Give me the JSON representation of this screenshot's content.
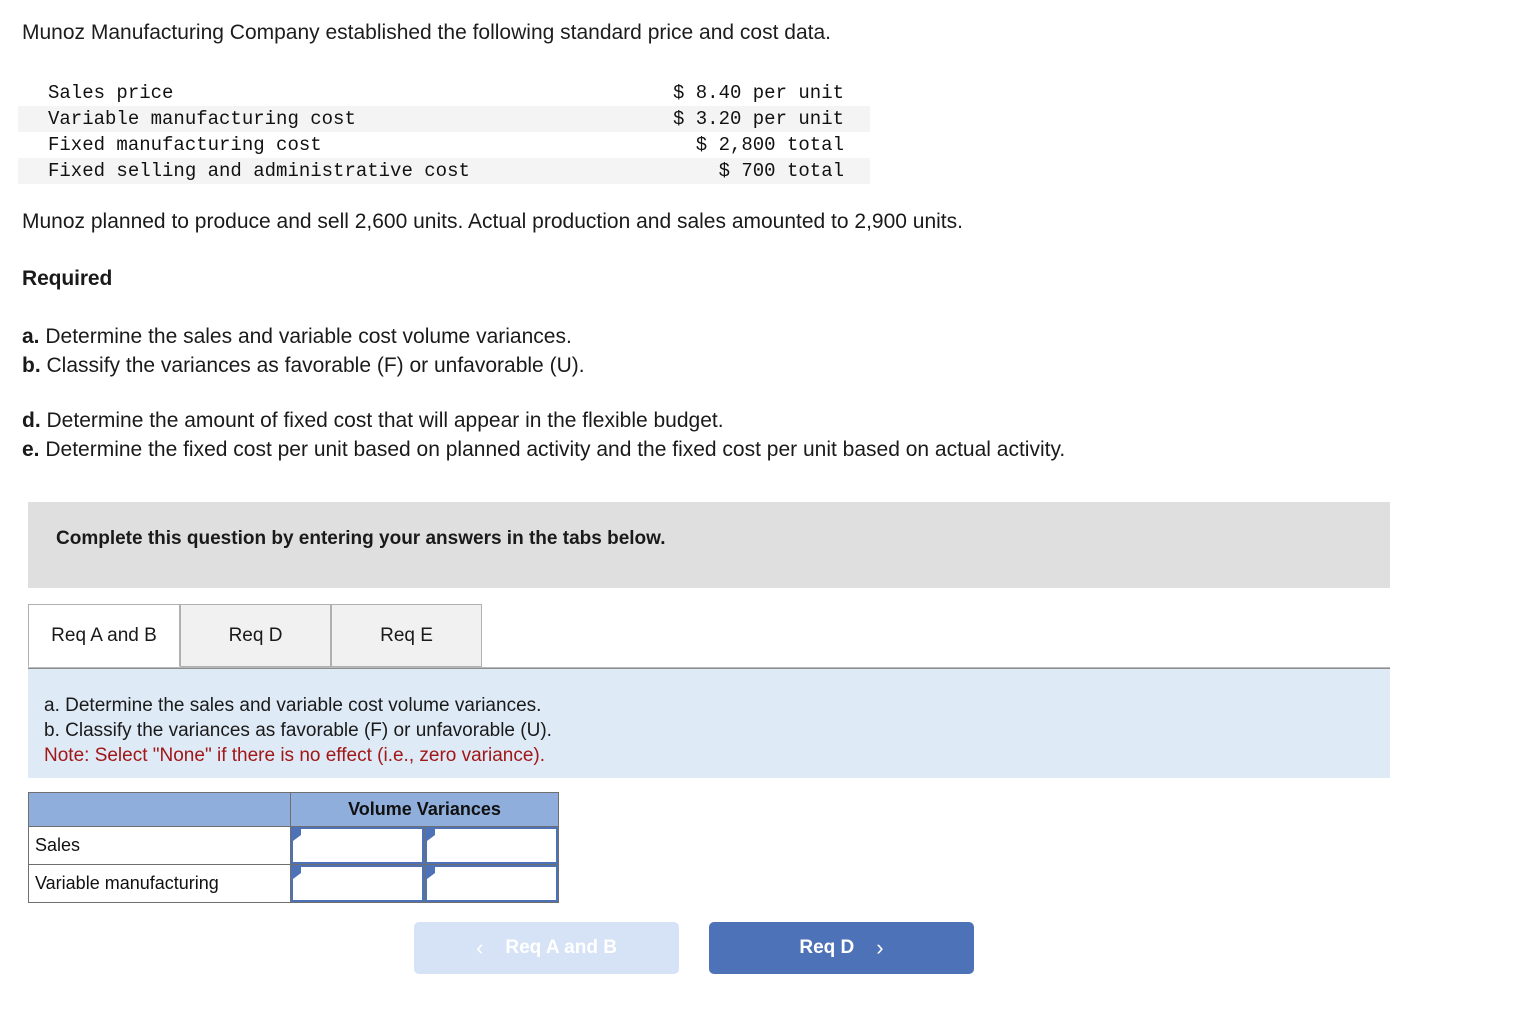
{
  "intro": {
    "text": "Munoz Manufacturing Company established the following standard price and cost data."
  },
  "standards_table": {
    "rows": [
      {
        "label": "Sales price",
        "value": "$ 8.40 per unit",
        "shaded": false
      },
      {
        "label": "Variable manufacturing cost",
        "value": "$ 3.20 per unit",
        "shaded": true
      },
      {
        "label": "Fixed manufacturing cost",
        "value": "$ 2,800 total",
        "shaded": false
      },
      {
        "label": "Fixed selling and administrative cost",
        "value": "$ 700 total",
        "shaded": true
      }
    ]
  },
  "paragraph2": {
    "text": "Munoz planned to produce and sell 2,600 units. Actual production and sales amounted to 2,900 units."
  },
  "required": {
    "heading": "Required",
    "group1": [
      {
        "marker": "a.",
        "text": "Determine the sales and variable cost volume variances."
      },
      {
        "marker": "b.",
        "text": "Classify the variances as favorable (F) or unfavorable (U)."
      }
    ],
    "group2": [
      {
        "marker": "d.",
        "text": "Determine the amount of fixed cost that will appear in the flexible budget."
      },
      {
        "marker": "e.",
        "text": "Determine the fixed cost per unit based on planned activity and the fixed cost per unit based on actual activity."
      }
    ]
  },
  "banner": {
    "text": "Complete this question by entering your answers in the tabs below."
  },
  "tabs": [
    {
      "label": "Req A and B",
      "active": true
    },
    {
      "label": "Req D",
      "active": false
    },
    {
      "label": "Req E",
      "active": false
    }
  ],
  "instruction_panel": {
    "line1": "a. Determine the sales and variable cost volume variances.",
    "line2": "b. Classify the variances as favorable (F) or unfavorable (U).",
    "note": "Note: Select \"None\" if there is no effect (i.e., zero variance)."
  },
  "answer_table": {
    "header_blank": "",
    "header_span": "Volume Variances",
    "rows": [
      {
        "label": "Sales",
        "amount": "",
        "classification": ""
      },
      {
        "label": "Variable manufacturing",
        "amount": "",
        "classification": ""
      }
    ]
  },
  "nav": {
    "prev_label": "Req A and B",
    "prev_chevron": "‹",
    "next_label": "Req D",
    "next_chevron": "›"
  },
  "colors": {
    "banner_gray": "#dfdfdf",
    "panel_blue": "#deeaf6",
    "table_header_blue": "#8faedc",
    "input_border_blue": "#4e72b8",
    "note_red": "#a11616",
    "button_primary": "#4e72b8",
    "button_disabled": "#d6e2f5"
  }
}
